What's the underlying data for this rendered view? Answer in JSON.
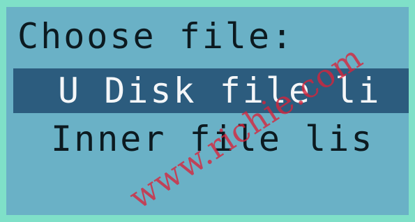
{
  "screen": {
    "title": "Choose file:",
    "menu": [
      {
        "label": "U Disk file li",
        "selected": true
      },
      {
        "label": "Inner file lis",
        "selected": false
      }
    ]
  },
  "watermark": {
    "text": "www.richie.com"
  },
  "colors": {
    "bezel": "#7fe0c8",
    "screen_bg": "#6ab1c6",
    "highlight_bg": "#2c5c7e",
    "highlight_text": "#f4f6f8",
    "text": "#0c1a20",
    "watermark": "#d9233a"
  }
}
